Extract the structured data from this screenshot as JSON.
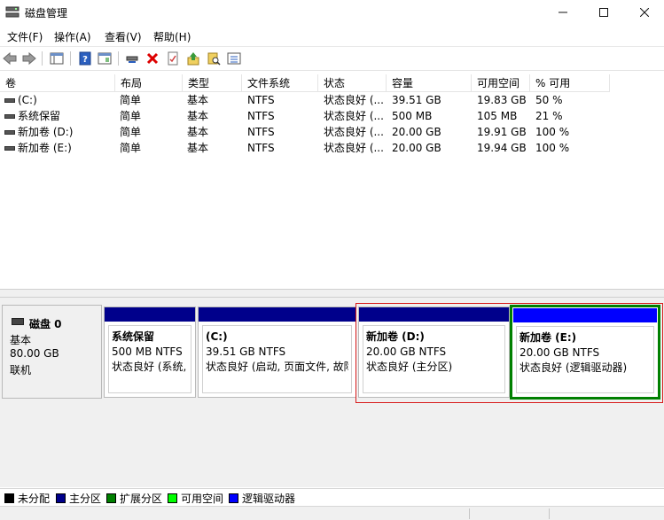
{
  "window": {
    "title": "磁盘管理",
    "minimize": "—",
    "maximize": "☐",
    "close": "✕"
  },
  "menu": [
    "文件(F)",
    "操作(A)",
    "查看(V)",
    "帮助(H)"
  ],
  "toolbar": {
    "icons": [
      "back-arrow-icon",
      "forward-arrow-icon",
      "console-tree-icon",
      "help-icon",
      "help-topics-icon",
      "connect-disk-icon",
      "delete-icon",
      "properties-check-icon",
      "upload-icon",
      "search-icon",
      "list-view-icon"
    ]
  },
  "table": {
    "columns": [
      "卷",
      "布局",
      "类型",
      "文件系统",
      "状态",
      "容量",
      "可用空间",
      "% 可用"
    ],
    "rows": [
      {
        "volume": "(C:)",
        "layout": "简单",
        "type": "基本",
        "fs": "NTFS",
        "status": "状态良好 (...",
        "capacity": "39.51 GB",
        "free": "19.83 GB",
        "pct": "50 %"
      },
      {
        "volume": "系统保留",
        "layout": "简单",
        "type": "基本",
        "fs": "NTFS",
        "status": "状态良好 (...",
        "capacity": "500 MB",
        "free": "105 MB",
        "pct": "21 %"
      },
      {
        "volume": "新加卷 (D:)",
        "layout": "简单",
        "type": "基本",
        "fs": "NTFS",
        "status": "状态良好 (...",
        "capacity": "20.00 GB",
        "free": "19.91 GB",
        "pct": "100 %"
      },
      {
        "volume": "新加卷 (E:)",
        "layout": "简单",
        "type": "基本",
        "fs": "NTFS",
        "status": "状态良好 (...",
        "capacity": "20.00 GB",
        "free": "19.94 GB",
        "pct": "100 %"
      }
    ]
  },
  "disk": {
    "name": "磁盘 0",
    "type": "基本",
    "size": "80.00 GB",
    "state": "联机",
    "partitions": [
      {
        "name": "系统保留",
        "size": "500 MB NTFS",
        "status": "状态良好 (系统, 活"
      },
      {
        "name": "(C:)",
        "size": "39.51 GB NTFS",
        "status": "状态良好 (启动, 页面文件, 故障"
      },
      {
        "name": "新加卷 (D:)",
        "size": "20.00 GB NTFS",
        "status": "状态良好 (主分区)"
      },
      {
        "name": "新加卷 (E:)",
        "size": "20.00 GB NTFS",
        "status": "状态良好 (逻辑驱动器)"
      }
    ]
  },
  "legend": [
    {
      "label": "未分配",
      "color": "#000000"
    },
    {
      "label": "主分区",
      "color": "#00008b"
    },
    {
      "label": "扩展分区",
      "color": "#008000"
    },
    {
      "label": "可用空间",
      "color": "#00ff00"
    },
    {
      "label": "逻辑驱动器",
      "color": "#0000ff"
    }
  ],
  "colors": {
    "primary_bar": "#00008b",
    "logical_bar": "#0000ff",
    "extended_border": "#008000",
    "selection_border": "#d81b1b"
  }
}
